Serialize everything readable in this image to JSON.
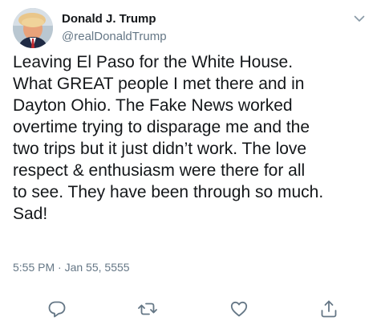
{
  "author": {
    "display_name": "Donald J. Trump",
    "handle": "@realDonaldTrump",
    "avatar_icon": "profile-photo"
  },
  "tweet": {
    "text": "Leaving El Paso for the White House.\nWhat GREAT people I met there and in\nDayton Ohio. The Fake News worked\novertime trying to disparage me and the\ntwo trips but it just didn’t work. The love\nrespect & enthusiasm were there for all\nto see. They have been through so much.\nSad!",
    "time": "5:55 PM",
    "separator": " · ",
    "date": "Jan 55, 5555"
  },
  "icons": {
    "menu": "chevron-down-icon",
    "reply": "comment-icon",
    "retweet": "retweet-icon",
    "like": "heart-icon",
    "share": "share-icon"
  },
  "colors": {
    "text": "#14171a",
    "secondary": "#657786",
    "icon": "#657786"
  }
}
